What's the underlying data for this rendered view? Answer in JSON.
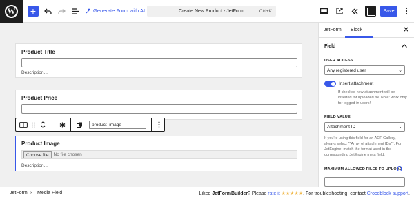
{
  "topbar": {
    "generate_label": "Generate Form with AI",
    "command_title": "Create New Product - JetForm",
    "command_shortcut": "Ctrl+K",
    "save_label": "Save"
  },
  "canvas": {
    "fields": [
      {
        "label": "Product Title",
        "description": "Description..."
      },
      {
        "label": "Product Price"
      },
      {
        "label": "Product Image",
        "choose_file": "Choose file",
        "no_file": "No file chosen",
        "description": "Description..."
      }
    ],
    "toolbar": {
      "field_name": "product_image"
    }
  },
  "sidebar": {
    "tabs": [
      "JetForm",
      "Block"
    ],
    "section_title": "Field",
    "user_access_label": "USER ACCESS",
    "user_access_value": "Any registered user",
    "insert_attachment_label": "Insert attachment",
    "insert_attachment_help": "If checked new attachment will be inserted for uploaded file.Note: work only for logged-in users!",
    "field_value_label": "FIELD VALUE",
    "field_value_value": "Attachment ID",
    "field_value_help": "If you're using this field for an ACF Gallery, always select **Array of attachment IDs**. For JetEngine, match the format used in the corresponding JetEngine meta field.",
    "max_files_label": "MAXIMUM ALLOWED FILES TO UPLOAD"
  },
  "footer": {
    "crumbs": [
      "JetForm",
      "Media Field"
    ],
    "note_prefix": "Liked ",
    "note_brand": "JetFormBuilder",
    "note_mid": "? Please ",
    "note_rate": "rate it",
    "note_stars": " ★★★★★",
    "note_trouble": ". For troubleshooting, contact ",
    "note_support": "Crocoblock support",
    "note_end": "."
  },
  "colors": {
    "accent": "#3858e9",
    "dark": "#1e1e1e",
    "canvas_bg": "#f0f0f0"
  }
}
